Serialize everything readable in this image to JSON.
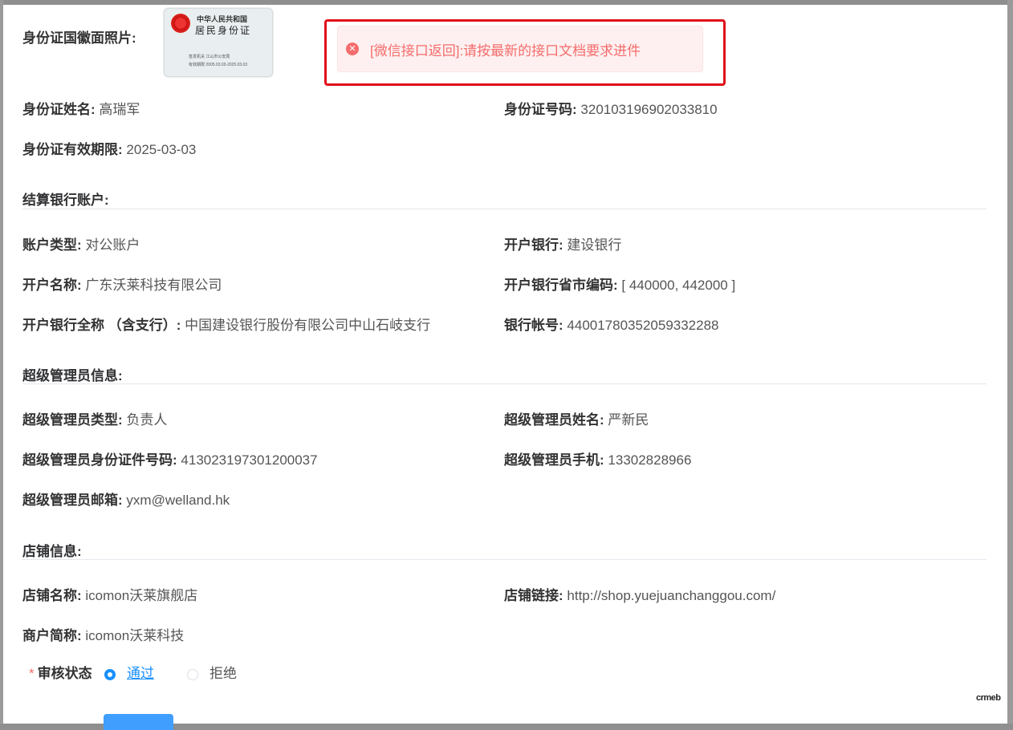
{
  "id_card": {
    "emblem_label": "身份证国徽面照片:",
    "card_title_line1": "中华人民共和国",
    "card_title_line2": "居民身份证",
    "card_issuer": "江山市公安局",
    "card_validity": "2005.03.03-2025.03.03",
    "card_label1": "签发机关",
    "card_label2": "有效期限"
  },
  "toast": {
    "message": "[微信接口返回]:请按最新的接口文档要求进件"
  },
  "identity": {
    "name_label": "身份证姓名:",
    "name_value": "高瑞军",
    "number_label": "身份证号码:",
    "number_value": "320103196902033810",
    "expiry_label": "身份证有效期限:",
    "expiry_value": "2025-03-03"
  },
  "bank": {
    "section_title": "结算银行账户:",
    "account_type_label": "账户类型:",
    "account_type_value": "对公账户",
    "bank_label": "开户银行:",
    "bank_value": "建设银行",
    "account_name_label": "开户名称:",
    "account_name_value": "广东沃莱科技有限公司",
    "region_code_label": "开户银行省市编码:",
    "region_code_value": "[ 440000, 442000 ]",
    "branch_label": "开户银行全称 （含支行）:",
    "branch_value": "中国建设银行股份有限公司中山石岐支行",
    "account_no_label": "银行帐号:",
    "account_no_value": "44001780352059332288"
  },
  "admin": {
    "section_title": "超级管理员信息:",
    "type_label": "超级管理员类型:",
    "type_value": "负责人",
    "name_label": "超级管理员姓名:",
    "name_value": "严新民",
    "id_label": "超级管理员身份证件号码:",
    "id_value": "413023197301200037",
    "phone_label": "超级管理员手机:",
    "phone_value": "13302828966",
    "email_label": "超级管理员邮箱:",
    "email_value": "yxm@welland.hk"
  },
  "store": {
    "section_title": "店铺信息:",
    "name_label": "店铺名称:",
    "name_value": "icomon沃莱旗舰店",
    "link_label": "店铺链接:",
    "link_value": "http://shop.yuejuanchanggou.com/",
    "short_label": "商户简称:",
    "short_value": "icomon沃莱科技"
  },
  "review": {
    "required_mark": "*",
    "label": "审核状态",
    "option_pass": "通过",
    "option_reject": "拒绝",
    "selected": "通过"
  },
  "brand": {
    "mark": "crmeb"
  },
  "colors": {
    "primary": "#1890ff",
    "error": "#f56c6c",
    "highlight_border": "#e0101a"
  }
}
